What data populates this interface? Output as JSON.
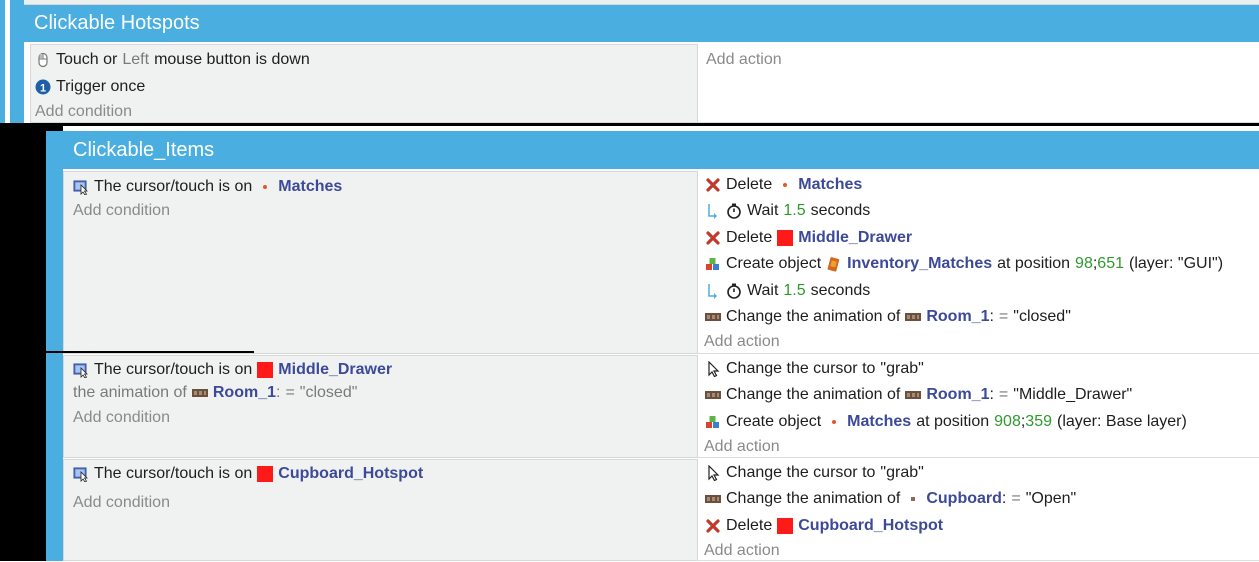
{
  "groups": {
    "g1_title": "Clickable Hotspots",
    "g2_title": "Clickable_Items"
  },
  "event0": {
    "conditions": [
      {
        "prefix": "Touch or",
        "mid": "Left",
        "suffix": "mouse button is down"
      },
      {
        "text": "Trigger once"
      }
    ],
    "add_condition": "Add condition",
    "add_action": "Add action"
  },
  "event1": {
    "cond_text": "The cursor/touch is on",
    "cond_obj": "Matches",
    "add_condition": "Add condition",
    "a1": {
      "verb": "Delete",
      "obj": "Matches"
    },
    "a2": {
      "word": "Wait",
      "num": "1.5",
      "unit": "seconds"
    },
    "a3": {
      "verb": "Delete",
      "obj": "Middle_Drawer"
    },
    "a4": {
      "verb": "Create object",
      "obj": "Inventory_Matches",
      "mid": "at position",
      "x": "98",
      "sep": ";",
      "y": "651",
      "layer": "(layer: \"GUI\")"
    },
    "a5": {
      "word": "Wait",
      "num": "1.5",
      "unit": "seconds"
    },
    "a6": {
      "verb": "Change the animation of",
      "obj": "Room_1",
      "op": ":",
      "eq": "=",
      "value": "\"closed\""
    },
    "add_action": "Add action"
  },
  "event2": {
    "cond_text": "The cursor/touch is on",
    "cond_obj": "Middle_Drawer",
    "cond2_prefix": "the animation of",
    "cond2_obj": "Room_1",
    "cond2_op": ":",
    "cond2_eq": "=",
    "cond2_value": "\"closed\"",
    "add_condition": "Add condition",
    "a1": {
      "verb": "Change the cursor to",
      "value": "\"grab\""
    },
    "a2": {
      "verb": "Change the animation of",
      "obj": "Room_1",
      "op": ":",
      "eq": "=",
      "value": "\"Middle_Drawer\""
    },
    "a3": {
      "verb": "Create object",
      "obj": "Matches",
      "mid": "at position",
      "x": "908",
      "sep": ";",
      "y": "359",
      "layer": "(layer: Base layer)"
    },
    "add_action": "Add action"
  },
  "event3": {
    "cond_text": "The cursor/touch is on",
    "cond_obj": "Cupboard_Hotspot",
    "add_condition": "Add condition",
    "a1": {
      "verb": "Change the cursor to",
      "value": "\"grab\""
    },
    "a2": {
      "verb": "Change the animation of",
      "obj": "Cupboard",
      "op": ":",
      "eq": "=",
      "value": "\"Open\""
    },
    "a3": {
      "verb": "Delete",
      "obj": "Cupboard_Hotspot"
    },
    "add_action": "Add action"
  },
  "colors": {
    "header_blue": "#4aaee0",
    "object_name": "#3c4a98",
    "number_green": "#2e9a2e",
    "delete_red": "#c0392b",
    "red_square": "#ff1a1a"
  }
}
